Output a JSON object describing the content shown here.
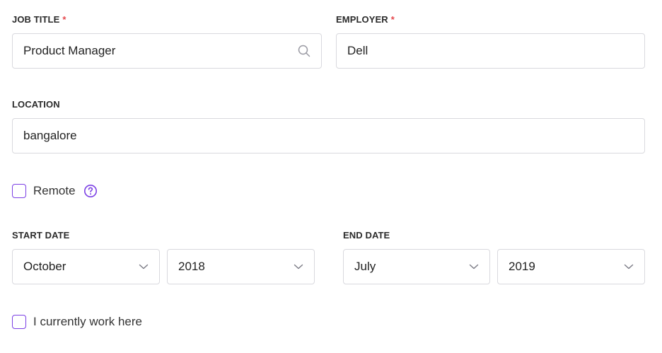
{
  "job_title": {
    "label": "JOB TITLE",
    "required_mark": "*",
    "value": "Product Manager",
    "icon": "search-icon"
  },
  "employer": {
    "label": "EMPLOYER",
    "required_mark": "*",
    "value": "Dell"
  },
  "location": {
    "label": "LOCATION",
    "value": "bangalore"
  },
  "remote": {
    "label": "Remote",
    "checked": false,
    "icon": "help-circle-icon"
  },
  "start_date": {
    "label": "START DATE",
    "month": "October",
    "year": "2018"
  },
  "end_date": {
    "label": "END DATE",
    "month": "July",
    "year": "2019"
  },
  "current_job": {
    "label": "I currently work here",
    "checked": false
  },
  "colors": {
    "accent": "#7b3fe4",
    "required": "#e5484d",
    "border": "#d9d9de"
  }
}
